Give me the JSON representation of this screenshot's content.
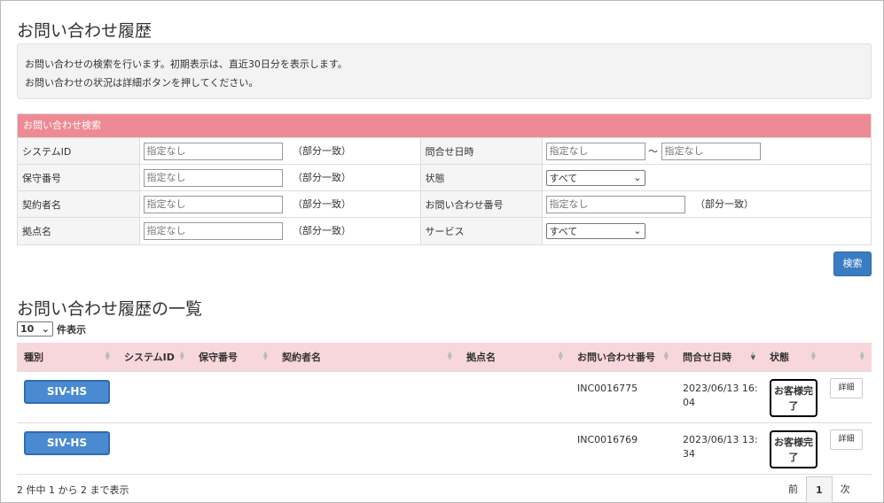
{
  "page": {
    "title": "お問い合わせ履歴",
    "info_lines": [
      "お問い合わせの検索を行います。初期表示は、直近30日分を表示します。",
      "お問い合わせの状況は詳細ボタンを押してください。"
    ]
  },
  "search": {
    "header": "お問い合わせ検索",
    "placeholder": "指定なし",
    "partial_match": "（部分一致）",
    "range_sep": "〜",
    "labels": {
      "system_id": "システムID",
      "maintenance_no": "保守番号",
      "contractor": "契約者名",
      "site": "拠点名",
      "inquiry_date": "問合せ日時",
      "status": "状態",
      "inquiry_no": "お問い合わせ番号",
      "service": "サービス"
    },
    "status_value": "すべて",
    "service_value": "すべて",
    "button": "検索"
  },
  "list": {
    "title": "お問い合わせ履歴の一覧",
    "page_length": "10",
    "page_length_suffix": "件表示",
    "columns": [
      "種別",
      "システムID",
      "保守番号",
      "契約者名",
      "拠点名",
      "お問い合わせ番号",
      "問合せ日時",
      "状態",
      ""
    ],
    "rows": [
      {
        "type": "SIV-HS",
        "system_id": "",
        "maintenance_no": "",
        "contractor": "",
        "site": "",
        "inquiry_no": "INC0016775",
        "date_line1": "2023/06/13 16:",
        "date_line2": "04",
        "status_line1": "お客様完",
        "status_line2": "了",
        "detail": "詳細"
      },
      {
        "type": "SIV-HS",
        "system_id": "",
        "maintenance_no": "",
        "contractor": "",
        "site": "",
        "inquiry_no": "INC0016769",
        "date_line1": "2023/06/13 13:",
        "date_line2": "34",
        "status_line1": "お客様完",
        "status_line2": "了",
        "detail": "詳細"
      }
    ],
    "summary": "2 件中 1 から 2 まで表示",
    "pager": {
      "prev": "前",
      "current": "1",
      "next": "次"
    }
  },
  "colors": {
    "accent_pink": "#ee8a93",
    "header_pink": "#f8d7da",
    "primary_blue": "#3a7cc1"
  }
}
